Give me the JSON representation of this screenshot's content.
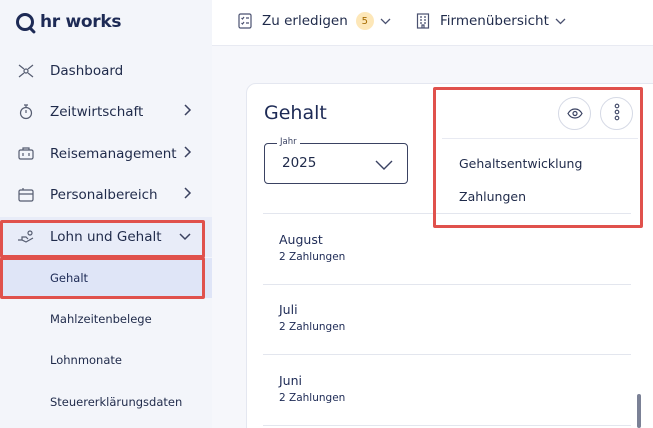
{
  "app": {
    "logo_text": "hr works"
  },
  "sidebar": {
    "items": [
      {
        "label": "Dashboard",
        "icon": "dashboard-icon"
      },
      {
        "label": "Zeitwirtschaft",
        "icon": "stopwatch-icon"
      },
      {
        "label": "Reisemanagement",
        "icon": "travel-icon"
      },
      {
        "label": "Personalbereich",
        "icon": "personal-area-icon"
      },
      {
        "label": "Lohn und Gehalt",
        "icon": "salary-icon"
      }
    ],
    "subitems": [
      {
        "label": "Gehalt",
        "active": true
      },
      {
        "label": "Mahlzeitenbelege"
      },
      {
        "label": "Lohnmonate"
      },
      {
        "label": "Steuererklärungsdaten"
      }
    ]
  },
  "topbar": {
    "todo": {
      "label": "Zu erledigen",
      "count": "5"
    },
    "company": {
      "label": "Firmenübersicht"
    }
  },
  "card": {
    "title": "Gehalt",
    "year_field": {
      "legend": "Jahr",
      "value": "2025"
    },
    "menu": [
      "Gehaltsentwicklung",
      "Zahlungen"
    ],
    "months": [
      {
        "month": "August",
        "payments": "2 Zahlungen"
      },
      {
        "month": "Juli",
        "payments": "2 Zahlungen"
      },
      {
        "month": "Juni",
        "payments": "2 Zahlungen"
      }
    ]
  },
  "colors": {
    "highlight": "#e0514c",
    "active_bg": "#dfe5f7",
    "brand": "#1d2a55",
    "badge_bg": "#fde7b8"
  }
}
